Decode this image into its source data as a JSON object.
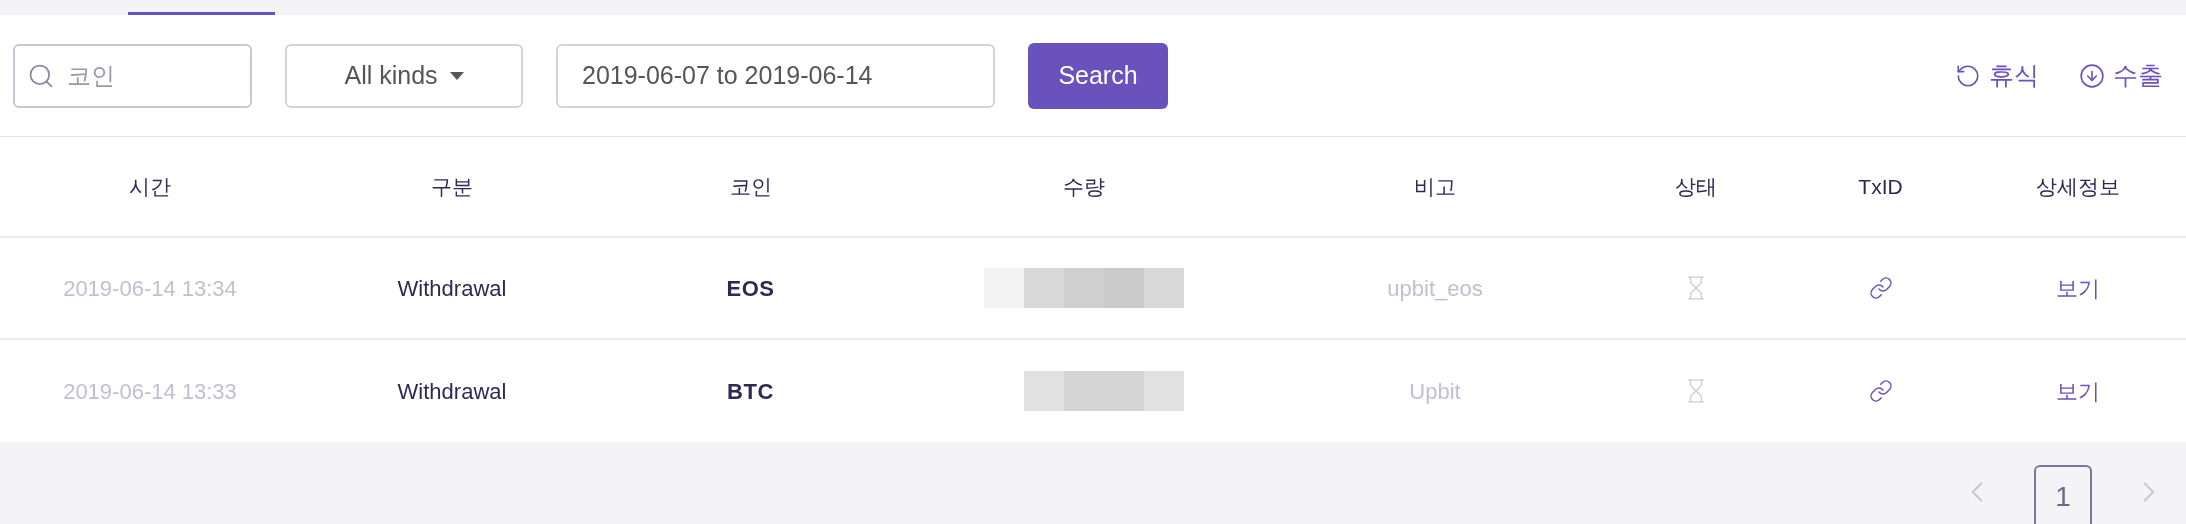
{
  "toolbar": {
    "search": {
      "placeholder": "코인"
    },
    "kind_select": {
      "value": "All kinds"
    },
    "date_range": {
      "value": "2019-06-07 to 2019-06-14"
    },
    "search_button": "Search",
    "actions": [
      {
        "kind": "reset",
        "label": "휴식"
      },
      {
        "kind": "export",
        "label": "수출"
      }
    ]
  },
  "table": {
    "columns": [
      "시간",
      "구분",
      "코인",
      "수량",
      "비고",
      "상태",
      "TxID",
      "상세정보"
    ],
    "rows": [
      {
        "time": "2019-06-14 13:34",
        "type": "Withdrawal",
        "coin": "EOS",
        "note": "upbit_eos",
        "detail": "보기"
      },
      {
        "time": "2019-06-14 13:33",
        "type": "Withdrawal",
        "coin": "BTC",
        "note": "Upbit",
        "detail": "보기"
      }
    ]
  },
  "pagination": {
    "pages": [
      {
        "label": "1",
        "selected": true
      }
    ]
  }
}
